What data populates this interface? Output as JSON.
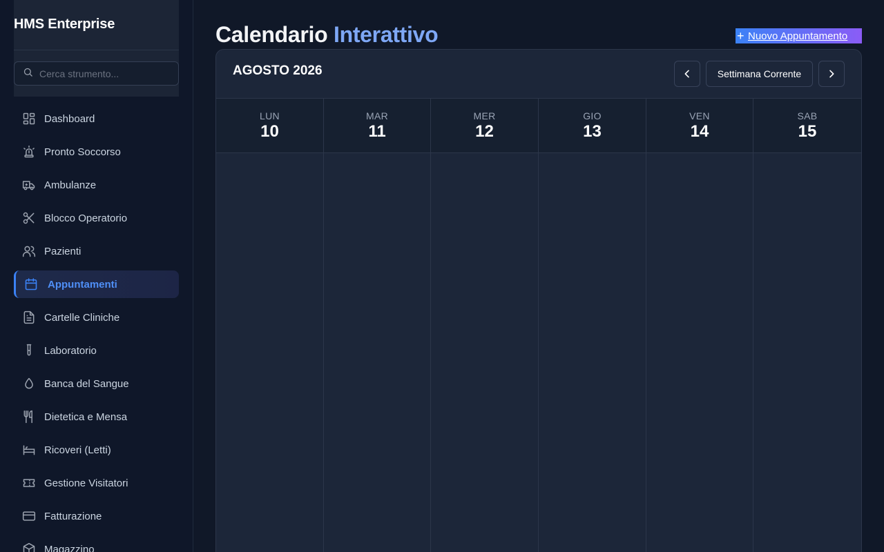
{
  "sidebar": {
    "brand": "HMS Enterprise",
    "search_placeholder": "Cerca strumento...",
    "items": [
      {
        "label": "Dashboard",
        "icon": "dashboard-icon"
      },
      {
        "label": "Pronto Soccorso",
        "icon": "siren-icon"
      },
      {
        "label": "Ambulanze",
        "icon": "ambulance-icon"
      },
      {
        "label": "Blocco Operatorio",
        "icon": "scissors-icon"
      },
      {
        "label": "Pazienti",
        "icon": "users-icon"
      },
      {
        "label": "Appuntamenti",
        "icon": "calendar-icon",
        "active": true
      },
      {
        "label": "Cartelle Cliniche",
        "icon": "file-text-icon"
      },
      {
        "label": "Laboratorio",
        "icon": "test-tube-icon"
      },
      {
        "label": "Banca del Sangue",
        "icon": "droplet-icon"
      },
      {
        "label": "Dietetica e Mensa",
        "icon": "utensils-icon"
      },
      {
        "label": "Ricoveri (Letti)",
        "icon": "bed-icon"
      },
      {
        "label": "Gestione Visitatori",
        "icon": "ticket-icon"
      },
      {
        "label": "Fatturazione",
        "icon": "credit-card-icon"
      },
      {
        "label": "Magazzino",
        "icon": "package-icon"
      }
    ]
  },
  "header": {
    "title_main": "Calendario",
    "title_accent": "Interattivo",
    "new_button": "Nuovo Appuntamento"
  },
  "calendar": {
    "month": "AGOSTO 2026",
    "current_week_label": "Settimana Corrente",
    "days": [
      {
        "dow": "LUN",
        "num": "10"
      },
      {
        "dow": "MAR",
        "num": "11"
      },
      {
        "dow": "MER",
        "num": "12"
      },
      {
        "dow": "GIO",
        "num": "13"
      },
      {
        "dow": "VEN",
        "num": "14"
      },
      {
        "dow": "SAB",
        "num": "15"
      }
    ]
  },
  "colors": {
    "accent": "#3b82f6",
    "accent_gradient_end": "#8b5cf6",
    "active_text": "#4f8ff7",
    "background": "#101828"
  }
}
